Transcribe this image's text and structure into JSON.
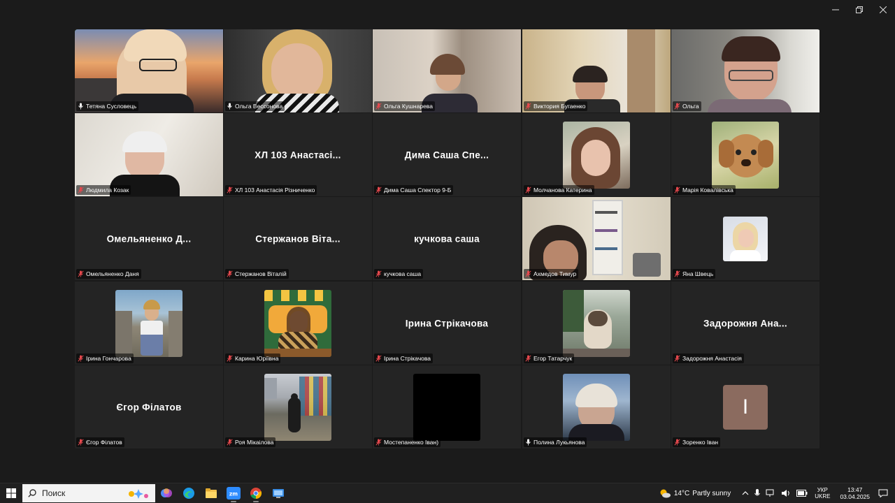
{
  "window": {
    "minimize": "—",
    "maximize": "❐",
    "close": "✕"
  },
  "participants": [
    {
      "name": "Тетяна Сусловець",
      "muted": false,
      "type": "video",
      "scene": "sunset",
      "active": true
    },
    {
      "name": "Ольга Вессонова",
      "muted": false,
      "type": "video",
      "scene": "woman-blonde"
    },
    {
      "name": "Ольга Кушнарева",
      "muted": true,
      "type": "video",
      "scene": "blurred-woman"
    },
    {
      "name": "Виктория Бугаенко",
      "muted": true,
      "type": "video",
      "scene": "room-window"
    },
    {
      "name": "Ольга",
      "muted": true,
      "type": "video",
      "scene": "older-woman"
    },
    {
      "name": "Людмила Козак",
      "muted": true,
      "type": "video",
      "scene": "older-woman-white"
    },
    {
      "name": "ХЛ 103 Анастасія Різниченко",
      "muted": true,
      "type": "name",
      "display": "ХЛ 103 Анастасі..."
    },
    {
      "name": "Дима Саша Спектор 9-Б",
      "muted": true,
      "type": "name",
      "display": "Дима Саша Спе..."
    },
    {
      "name": "Молчанова Катерина",
      "muted": true,
      "type": "photo",
      "scene": "girl-hair"
    },
    {
      "name": "Марія Ковалівська",
      "muted": true,
      "type": "photo",
      "scene": "puppy"
    },
    {
      "name": "Омельяненко Даня",
      "muted": true,
      "type": "name",
      "display": "Омельяненко Д..."
    },
    {
      "name": "Стержанов Віталій",
      "muted": true,
      "type": "name",
      "display": "Стержанов Віта..."
    },
    {
      "name": "кучкова саша",
      "muted": true,
      "type": "name",
      "display": "кучкова саша"
    },
    {
      "name": "Ахмедов Тимур",
      "muted": true,
      "type": "video",
      "scene": "boy-shelves"
    },
    {
      "name": "Яна Швець",
      "muted": true,
      "type": "photo-small",
      "scene": "blonde-small"
    },
    {
      "name": "Ірина Гончарова",
      "muted": true,
      "type": "photo",
      "scene": "beach-woman"
    },
    {
      "name": "Карина Юріївна",
      "muted": true,
      "type": "photo",
      "scene": "classroom"
    },
    {
      "name": "Ірина Стрікачова",
      "muted": true,
      "type": "name",
      "display": "Ірина Стрікачова"
    },
    {
      "name": "Егор Татарчук",
      "muted": true,
      "type": "photo",
      "scene": "cat"
    },
    {
      "name": "Задорожня Анастасія",
      "muted": true,
      "type": "name",
      "display": "Задорожня Ана..."
    },
    {
      "name": "Єгор Філатов",
      "muted": true,
      "type": "name",
      "display": "Єгор Філатов"
    },
    {
      "name": "Роя Мікаілова",
      "muted": true,
      "type": "photo",
      "scene": "street"
    },
    {
      "name": "Мостепаненко Іван)",
      "muted": true,
      "type": "black"
    },
    {
      "name": "Полина Лукьянова",
      "muted": false,
      "type": "photo",
      "scene": "winter-hat"
    },
    {
      "name": "Зоренко Іван",
      "muted": true,
      "type": "letter",
      "letter": "І"
    }
  ],
  "taskbar": {
    "search_placeholder": "Поиск",
    "apps": [
      "copilot-icon",
      "edge-icon",
      "file-explorer-icon",
      "zoom-icon",
      "chrome-icon",
      "remote-desktop-icon"
    ],
    "weather_temp": "14°C",
    "weather_desc": "Partly sunny",
    "lang_top": "УКР",
    "lang_bottom": "UKRE",
    "time": "13:47",
    "date": "03.04.2025"
  },
  "colors": {
    "active_speaker": "#4ade80",
    "tile_bg": "#242424",
    "mute_red": "#e5484d"
  }
}
